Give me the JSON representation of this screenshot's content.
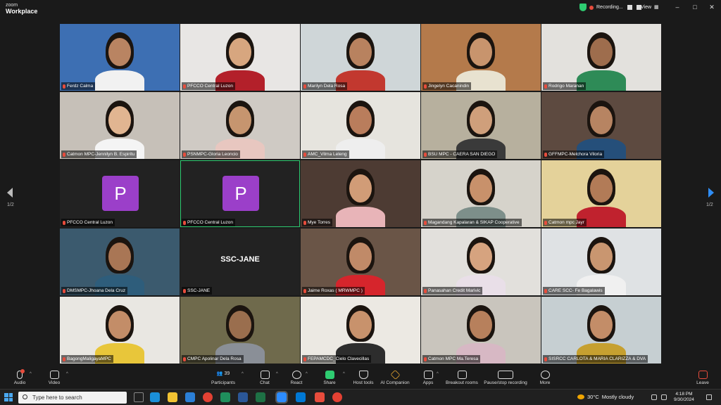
{
  "app": {
    "logo_line1": "zoom",
    "logo_line2": "Workplace"
  },
  "titlebar": {
    "recording": "Recording...",
    "view": "View",
    "minimize": "–",
    "maximize": "□",
    "close": "✕"
  },
  "pager": {
    "left": "1/2",
    "right": "1/2"
  },
  "tiles": [
    {
      "name": "Ferdz Calma",
      "bg": "#3d6fb3",
      "skin": "#b98462",
      "shirt": "#f1f1f1",
      "type": "video"
    },
    {
      "name": "PFCCO Central Luzon",
      "bg": "#e8e6e4",
      "skin": "#d7a67f",
      "shirt": "#b3202a",
      "type": "video"
    },
    {
      "name": "Marilyn Dela Rosa",
      "bg": "#cfd6d8",
      "skin": "#b8825f",
      "shirt": "#c2382f",
      "type": "video"
    },
    {
      "name": "Jingelyn Cacanindin",
      "bg": "#b47a4b",
      "skin": "#c8946d",
      "shirt": "#e8e2d0",
      "type": "video"
    },
    {
      "name": "Rodrigo Maranan",
      "bg": "#e3e1dd",
      "skin": "#9e6d4d",
      "shirt": "#2e8b57",
      "type": "video"
    },
    {
      "name": "Catmon MPC-Jennilyn B. Espiritu",
      "bg": "#c6c0b8",
      "skin": "#e1b591",
      "shirt": "#f4f4f4",
      "type": "video"
    },
    {
      "name": "PSNMPC-Gloria Leoncio",
      "bg": "#cfcac4",
      "skin": "#c6956f",
      "shirt": "#e8c7c0",
      "type": "video"
    },
    {
      "name": "AMC_Vilma Leleng",
      "bg": "#e6e4de",
      "skin": "#b97d5c",
      "shirt": "#eeeeee",
      "type": "video"
    },
    {
      "name": "BSU MPC - CAERA SAN DIEGO",
      "bg": "#b7b09e",
      "skin": "#cf9f7b",
      "shirt": "#3a3a3a",
      "type": "video"
    },
    {
      "name": "GFFMPC-Melchora Viloria",
      "bg": "#5d4a40",
      "skin": "#b78462",
      "shirt": "#254f7a",
      "type": "video"
    },
    {
      "name": "PFCCO Central Luzon",
      "avatar": "P",
      "type": "avatar"
    },
    {
      "name": "PFCCO Central Luzon",
      "avatar": "P",
      "type": "avatar",
      "active": true
    },
    {
      "name": "Mye Torres",
      "bg": "#4d3b33",
      "skin": "#d19c77",
      "shirt": "#e8b4b8",
      "type": "video"
    },
    {
      "name": "Magandang Kapalaran & SIKAP Cooperative",
      "bg": "#d6d3cb",
      "skin": "#c8916b",
      "shirt": "#7d8f8a",
      "type": "video"
    },
    {
      "name": "Catmon mpc Jayr",
      "bg": "#e4d29a",
      "skin": "#b27b57",
      "shirt": "#c0222e",
      "type": "video"
    },
    {
      "name": "DMSMPC-Jhoana Dela Cruz",
      "bg": "#3b5a6e",
      "skin": "#a97655",
      "shirt": "#2e5d7b",
      "type": "video"
    },
    {
      "name": "SSC-JANE",
      "big": "SSC-JANE",
      "type": "text"
    },
    {
      "name": "Jaime Roxas ( MRWMPC )",
      "bg": "#6a5547",
      "skin": "#c08a68",
      "shirt": "#d6252c",
      "type": "video"
    },
    {
      "name": "Panasahan Credit Marivic",
      "bg": "#e2e0dc",
      "skin": "#d6a37f",
      "shirt": "#e9dfe8",
      "type": "video"
    },
    {
      "name": "CARE SCC- Fe Bagalawis",
      "bg": "#dfe2e4",
      "skin": "#c99670",
      "shirt": "#f0f0f0",
      "type": "video"
    },
    {
      "name": "BagongMaligayaMPC",
      "bg": "#e9e7e2",
      "skin": "#c38d68",
      "shirt": "#e8c63a",
      "type": "video"
    },
    {
      "name": "CMPC Apolinar Dela Rosa",
      "bg": "#6f6a4c",
      "skin": "#9a6e4e",
      "shirt": "#8a8f97",
      "type": "video"
    },
    {
      "name": "FEPAMCDC_Cielo Clavecillas",
      "bg": "#ece9e3",
      "skin": "#c8926c",
      "shirt": "#2d2d2d",
      "type": "video"
    },
    {
      "name": "Catmon MPC Ma.Teresa",
      "bg": "#c9c5bd",
      "skin": "#b7805c",
      "shirt": "#d7b8c4",
      "type": "video"
    },
    {
      "name": "SISRCC CARLOTA & MARIA CLARIZZA & DVA",
      "bg": "#c6cfd2",
      "skin": "#c38d68",
      "shirt": "#c6a030",
      "type": "video"
    }
  ],
  "toolbar": {
    "audio": "Audio",
    "video": "Video",
    "participants": "Participants",
    "participants_count": "39",
    "chat": "Chat",
    "react": "React",
    "share": "Share",
    "host_tools": "Host tools",
    "ai_companion": "AI Companion",
    "apps": "Apps",
    "breakout": "Breakout rooms",
    "pause_recording": "Pause/stop recording",
    "more": "More",
    "leave": "Leave"
  },
  "taskbar": {
    "search_placeholder": "Type here to search",
    "weather_temp": "30°C",
    "weather_text": "Mostly cloudy",
    "time": "4:18 PM",
    "date": "9/30/2024"
  },
  "colors": {
    "accent_green": "#2ecc71",
    "avatar_purple": "#9b3fc9",
    "record_red": "#e74c3c"
  }
}
